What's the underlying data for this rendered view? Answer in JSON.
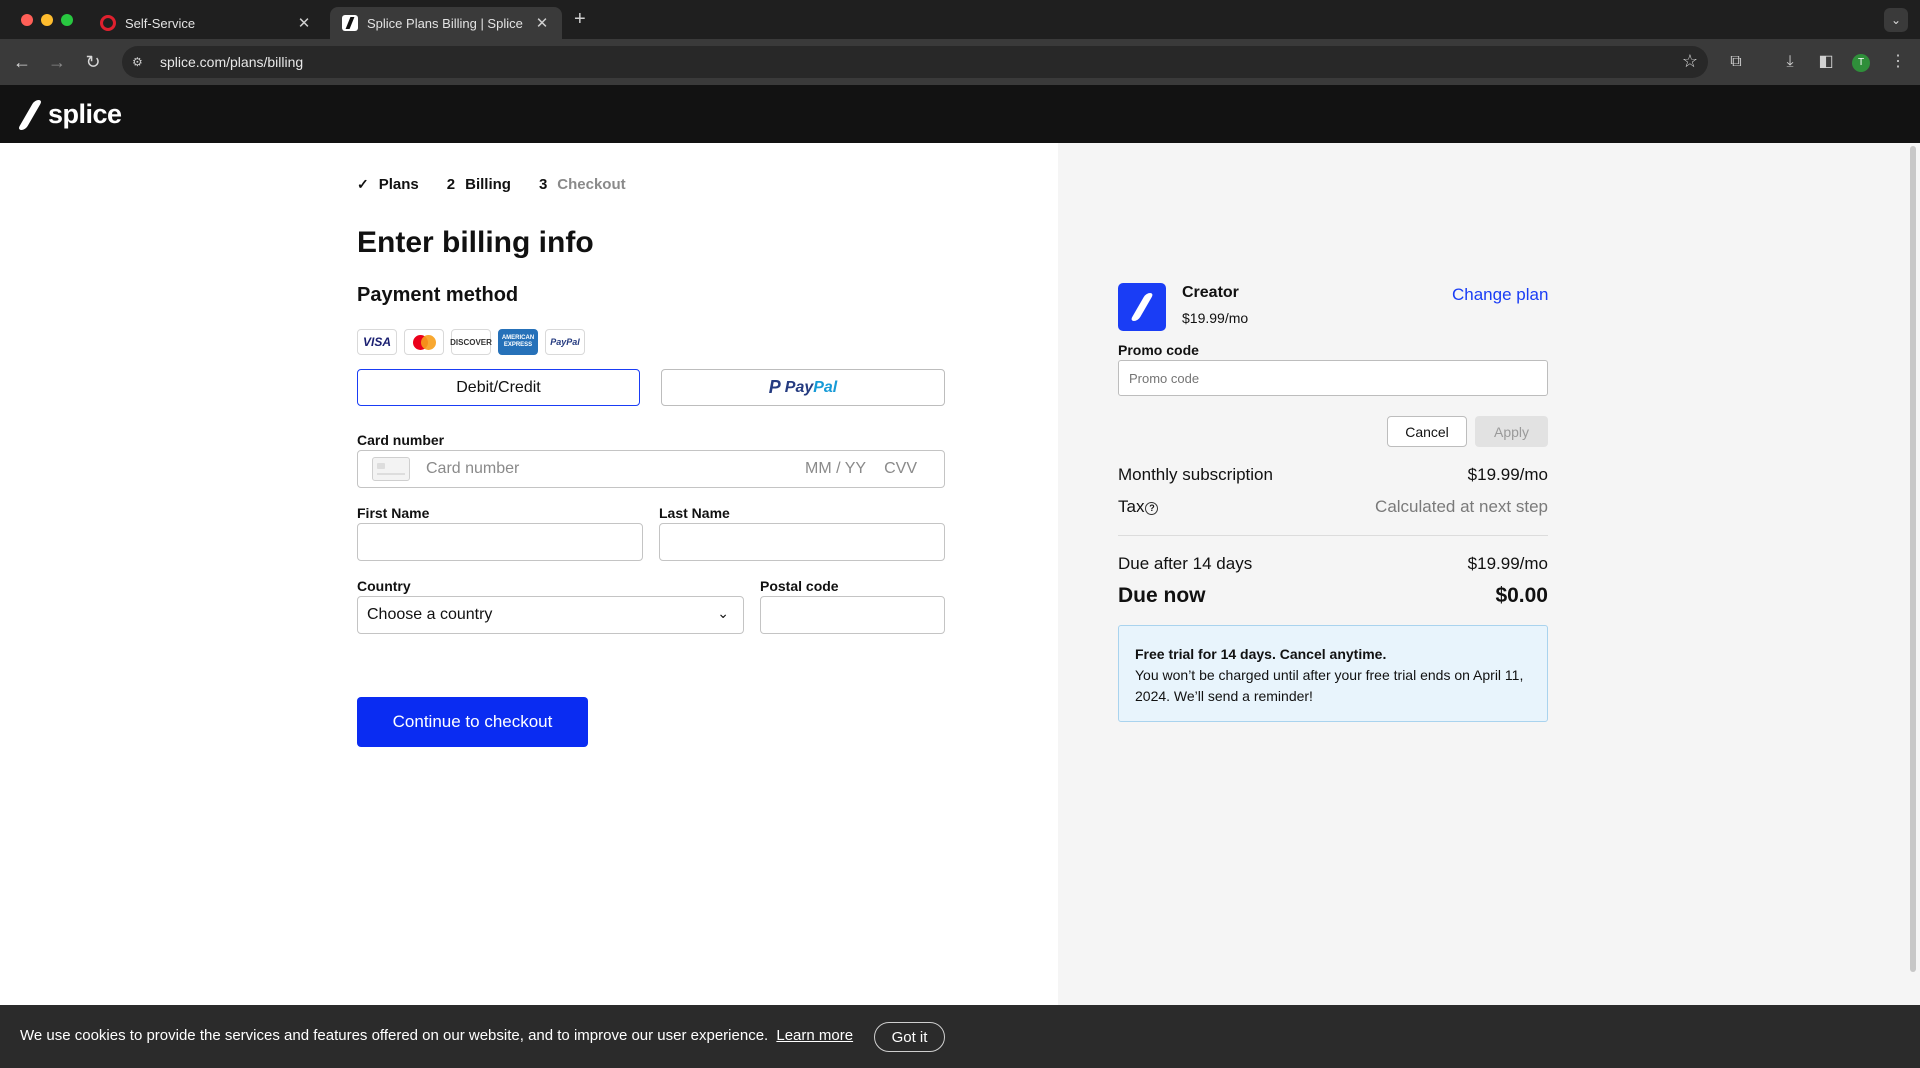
{
  "browser": {
    "tabs": [
      {
        "title": "Self-Service",
        "favicon": "opera-icon"
      },
      {
        "title": "Splice Plans Billing | Splice",
        "favicon": "splice-icon"
      }
    ],
    "url": "splice.com/plans/billing",
    "profile_initial": "T"
  },
  "site": {
    "logo_text": "splice"
  },
  "steps": [
    {
      "num": "✓",
      "label": "Plans",
      "state": "done"
    },
    {
      "num": "2",
      "label": "Billing",
      "state": "current"
    },
    {
      "num": "3",
      "label": "Checkout",
      "state": "upcoming"
    }
  ],
  "billing": {
    "title": "Enter billing info",
    "payment_method_title": "Payment method",
    "card_brands": [
      "VISA",
      "MasterCard",
      "DISCOVER",
      "AMERICAN EXPRESS",
      "PayPal"
    ],
    "debit_credit_label": "Debit/Credit",
    "paypal_label_a": "Pay",
    "paypal_label_b": "Pal",
    "card_number_label": "Card number",
    "card_number_placeholder": "Card number",
    "expiry_placeholder": "MM / YY",
    "cvv_placeholder": "CVV",
    "first_name_label": "First Name",
    "last_name_label": "Last Name",
    "country_label": "Country",
    "country_value": "Choose a country",
    "postal_label": "Postal code",
    "cta_label": "Continue to checkout"
  },
  "summary": {
    "plan_name": "Creator",
    "plan_price": "$19.99/mo",
    "change_plan": "Change plan",
    "promo_label": "Promo code",
    "promo_placeholder": "Promo code",
    "cancel_label": "Cancel",
    "apply_label": "Apply",
    "monthly_label": "Monthly subscription",
    "monthly_value": "$19.99/mo",
    "tax_label": "Tax",
    "tax_value": "Calculated at next step",
    "due_after_label": "Due after 14 days",
    "due_after_value": "$19.99/mo",
    "due_now_label": "Due now",
    "due_now_value": "$0.00",
    "trial_title": "Free trial for 14 days. Cancel anytime.",
    "trial_body": "You won’t be charged until after your free trial ends on April 11, 2024. We’ll send a reminder!"
  },
  "cookie": {
    "text": "We use cookies to provide the services and features offered on our website, and to improve our user experience.",
    "link": "Learn more",
    "button": "Got it"
  },
  "colors": {
    "accent": "#0a2cf2",
    "header_bg": "#121212",
    "panel_bg": "#f5f5f5",
    "trial_bg": "#e8f4fc"
  }
}
